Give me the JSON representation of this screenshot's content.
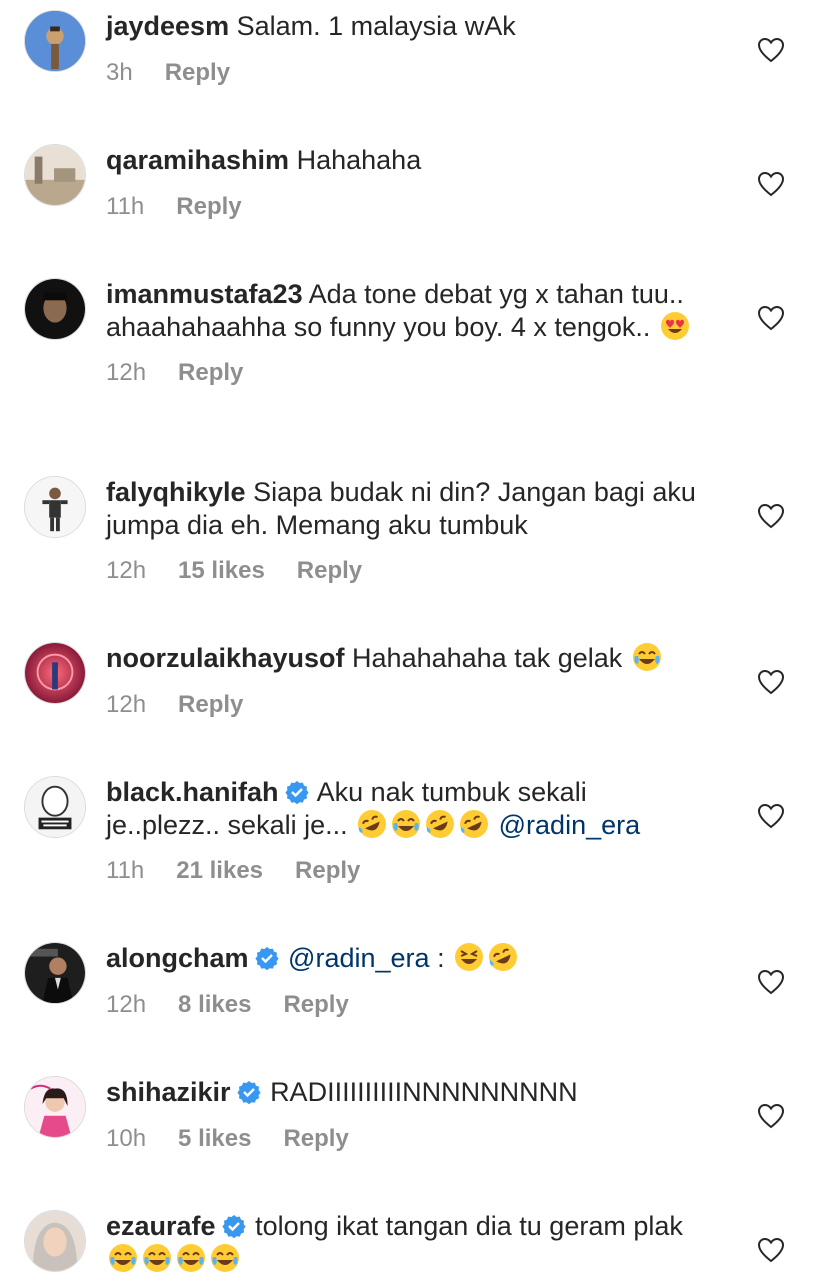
{
  "colors": {
    "text": "#262626",
    "meta": "#8e8e8e",
    "mention": "#003569",
    "verified": "#3897f0"
  },
  "comments": [
    {
      "username": "jaydeesm",
      "verified": false,
      "text": "Salam. 1 malaysia wAk",
      "time": "3h",
      "likes": "",
      "reply": "Reply",
      "avatar": "sky-avatar",
      "emojis": []
    },
    {
      "username": "qaramihashim",
      "verified": false,
      "text": "Hahahaha",
      "time": "11h",
      "likes": "",
      "reply": "Reply",
      "avatar": "landscape-avatar",
      "emojis": []
    },
    {
      "username": "imanmustafa23",
      "verified": false,
      "text": "Ada tone debat yg x tahan tuu.. ahaahahaahha so funny you boy. 4 x tengok..",
      "time": "12h",
      "likes": "",
      "reply": "Reply",
      "avatar": "dark-avatar",
      "emojis": [
        "heart-eyes"
      ]
    },
    {
      "username": "falyqhikyle",
      "verified": false,
      "text": "Siapa budak ni din? Jangan bagi aku jumpa dia eh. Memang aku tumbuk",
      "time": "12h",
      "likes": "15 likes",
      "reply": "Reply",
      "avatar": "person-avatar",
      "emojis": []
    },
    {
      "username": "noorzulaikhayusof",
      "verified": false,
      "text": "Hahahahaha tak gelak",
      "time": "12h",
      "likes": "",
      "reply": "Reply",
      "avatar": "neon-avatar",
      "emojis": [
        "joy"
      ]
    },
    {
      "username": "black.hanifah",
      "verified": true,
      "text": "Aku nak tumbuk sekali je..plezz.. sekali je...",
      "mention": "@radin_era",
      "time": "11h",
      "likes": "21 likes",
      "reply": "Reply",
      "avatar": "pokpet-avatar",
      "emojis": [
        "rofl",
        "joy",
        "rofl",
        "rofl"
      ]
    },
    {
      "username": "alongcham",
      "verified": true,
      "mention": "@radin_era",
      "text": ":",
      "time": "12h",
      "likes": "8 likes",
      "reply": "Reply",
      "avatar": "suit-avatar",
      "emojis": [
        "laughing",
        "rofl"
      ]
    },
    {
      "username": "shihazikir",
      "verified": true,
      "text": "RADIIIIIIIIIINNNNNNNNN",
      "time": "10h",
      "likes": "5 likes",
      "reply": "Reply",
      "avatar": "pink-avatar",
      "emojis": []
    },
    {
      "username": "ezaurafe",
      "verified": true,
      "text": "tolong ikat tangan dia tu geram plak",
      "time": "",
      "likes": "",
      "reply": "",
      "avatar": "hijab-avatar",
      "emojis": [
        "joy",
        "joy",
        "joy",
        "joy"
      ]
    }
  ]
}
